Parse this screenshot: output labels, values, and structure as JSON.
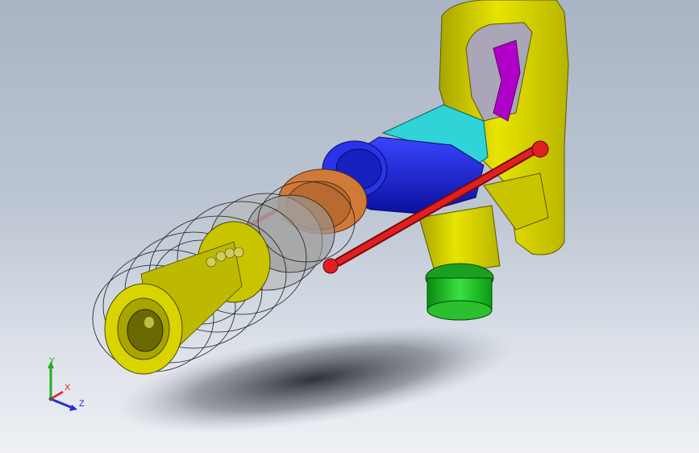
{
  "viewport": {
    "background_top": "#a9b4c4",
    "background_bottom": "#eef0f4"
  },
  "model": {
    "part_colors": {
      "handle": "#d9d400",
      "handle_dark": "#a8a400",
      "trigger": "#b000c8",
      "motor_housing": "#1a22d8",
      "collar": "#2fd3d8",
      "gear_ring": "#d07a3a",
      "rod": "#d81a1a",
      "bushing": "#1fbf2a",
      "chuck": "#d9d400",
      "internals": "#9a9a9a"
    }
  },
  "triad": {
    "labels": {
      "x": "X",
      "y": "Y",
      "z": "Z"
    },
    "colors": {
      "x": "#e02020",
      "y": "#20b020",
      "z": "#2030d0"
    }
  }
}
